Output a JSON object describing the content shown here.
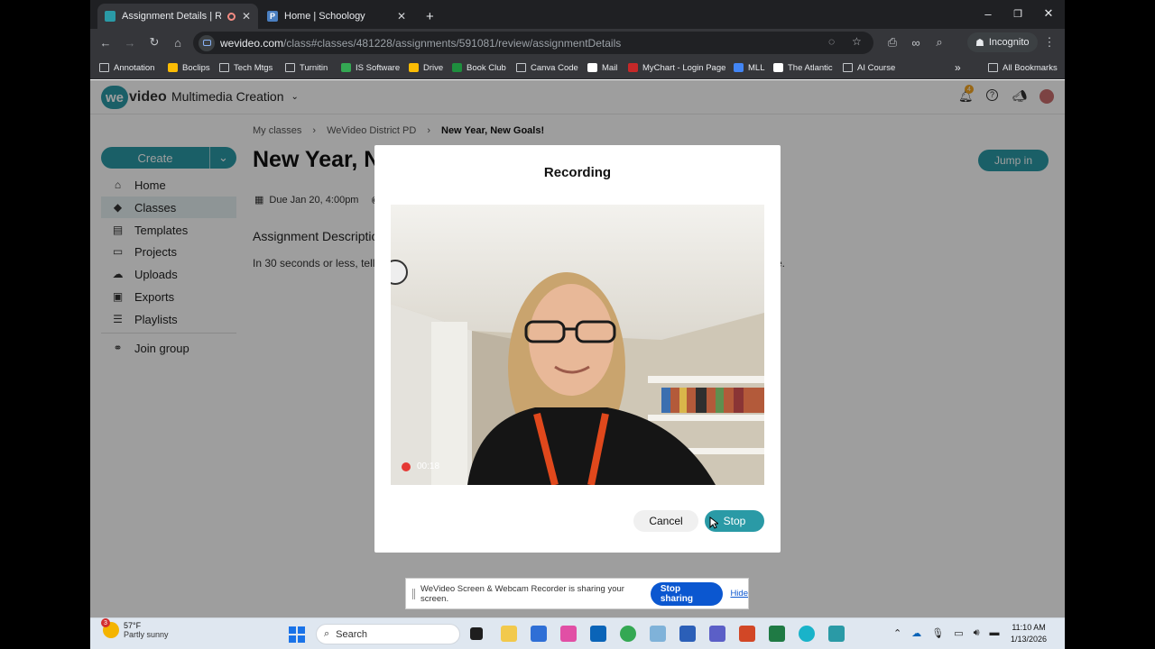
{
  "browser": {
    "tabs": [
      {
        "title": "Assignment Details | Review",
        "active": true
      },
      {
        "title": "Home | Schoology",
        "active": false
      }
    ],
    "new_tab": "+",
    "window_controls": {
      "minimize": "–",
      "restore": "❐",
      "close": "✕"
    },
    "url_host": "wevideo.com",
    "url_path": "/class#classes/481228/assignments/591081/review/assignmentDetails",
    "incognito_label": "Incognito",
    "bookmarks": [
      {
        "label": "Annotation",
        "icon": "folder-icon",
        "color": "#c4c7cb"
      },
      {
        "label": "Boclips",
        "icon": "boclips-icon",
        "color": "#fbbc04"
      },
      {
        "label": "Tech Mtgs",
        "icon": "folder-icon",
        "color": "#c4c7cb"
      },
      {
        "label": "Turnitin",
        "icon": "folder-icon",
        "color": "#c4c7cb"
      },
      {
        "label": "IS Software",
        "icon": "sheet-icon",
        "color": "#34a853"
      },
      {
        "label": "Drive",
        "icon": "drive-icon",
        "color": "#fbbc04"
      },
      {
        "label": "Book Club",
        "icon": "classroom-icon",
        "color": "#1e8e3e"
      },
      {
        "label": "Canva Code",
        "icon": "folder-icon",
        "color": "#c4c7cb"
      },
      {
        "label": "Mail",
        "icon": "x-icon",
        "color": "#ffffff"
      },
      {
        "label": "MyChart - Login Page",
        "icon": "mychart-icon",
        "color": "#c62828"
      },
      {
        "label": "MLL",
        "icon": "doc-icon",
        "color": "#4285f4"
      },
      {
        "label": "The Atlantic",
        "icon": "atlantic-icon",
        "color": "#ffffff"
      },
      {
        "label": "AI Course",
        "icon": "folder-icon",
        "color": "#c4c7cb"
      }
    ],
    "bookmarks_overflow": "»",
    "all_bookmarks": "All Bookmarks"
  },
  "app": {
    "logo_we": "we",
    "logo_video": "video",
    "workspace": "Multimedia Creation",
    "notification_count": "4",
    "accent": "#2a9aa6"
  },
  "sidebar": {
    "create_label": "Create",
    "items": [
      {
        "label": "Home",
        "icon": "home-icon",
        "glyph": "⌂"
      },
      {
        "label": "Classes",
        "icon": "classes-icon",
        "glyph": "◆"
      },
      {
        "label": "Templates",
        "icon": "templates-icon",
        "glyph": "▤"
      },
      {
        "label": "Projects",
        "icon": "projects-icon",
        "glyph": "▭"
      },
      {
        "label": "Uploads",
        "icon": "uploads-icon",
        "glyph": "☁"
      },
      {
        "label": "Exports",
        "icon": "exports-icon",
        "glyph": "▣"
      },
      {
        "label": "Playlists",
        "icon": "playlists-icon",
        "glyph": "☰"
      },
      {
        "label": "Join group",
        "icon": "join-group-icon",
        "glyph": "⚭"
      }
    ]
  },
  "main": {
    "breadcrumb": [
      "My classes",
      "WeVideo District PD",
      "New Year, New Goals!"
    ],
    "title": "New Year, N",
    "jump_in": "Jump in",
    "due": "Due Jan 20, 4:00pm",
    "desc_heading": "Assignment Descriptio",
    "desc_text": "In 30 seconds or less, tell",
    "desc_tail": "e."
  },
  "modal": {
    "title": "Recording",
    "timer": "00:18",
    "cancel": "Cancel",
    "stop": "Stop"
  },
  "share_bar": {
    "message": "WeVideo Screen & Webcam Recorder is sharing your screen.",
    "stop_sharing": "Stop sharing",
    "hide": "Hide"
  },
  "taskbar": {
    "weather_temp": "57°F",
    "weather_desc": "Partly sunny",
    "weather_badge": "3",
    "search_placeholder": "Search",
    "time": "11:10 AM",
    "date": "1/13/2026"
  }
}
